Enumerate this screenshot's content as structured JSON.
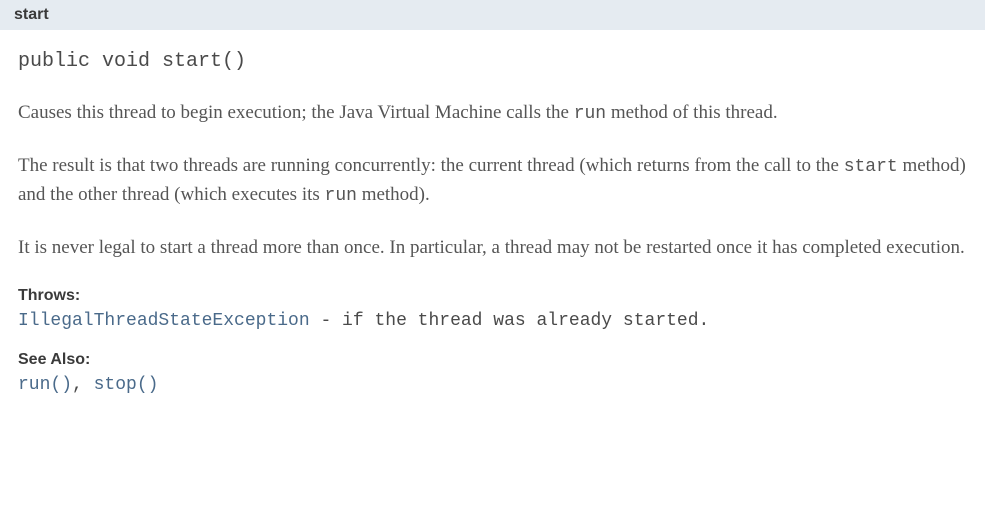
{
  "method": {
    "name": "start",
    "signature": "public void start()",
    "description": {
      "para1_part1": "Causes this thread to begin execution; the Java Virtual Machine calls the ",
      "para1_code1": "run",
      "para1_part2": " method of this thread.",
      "para2_part1": "The result is that two threads are running concurrently: the current thread (which returns from the call to the ",
      "para2_code1": "start",
      "para2_part2": " method) and the other thread (which executes its ",
      "para2_code2": "run",
      "para2_part3": " method).",
      "para3": "It is never legal to start a thread more than once. In particular, a thread may not be restarted once it has completed execution."
    },
    "throws": {
      "label": "Throws:",
      "exception": "IllegalThreadStateException",
      "condition": " - if the thread was already started."
    },
    "seeAlso": {
      "label": "See Also:",
      "refs": [
        "run()",
        "stop()"
      ],
      "separator": ", "
    }
  }
}
